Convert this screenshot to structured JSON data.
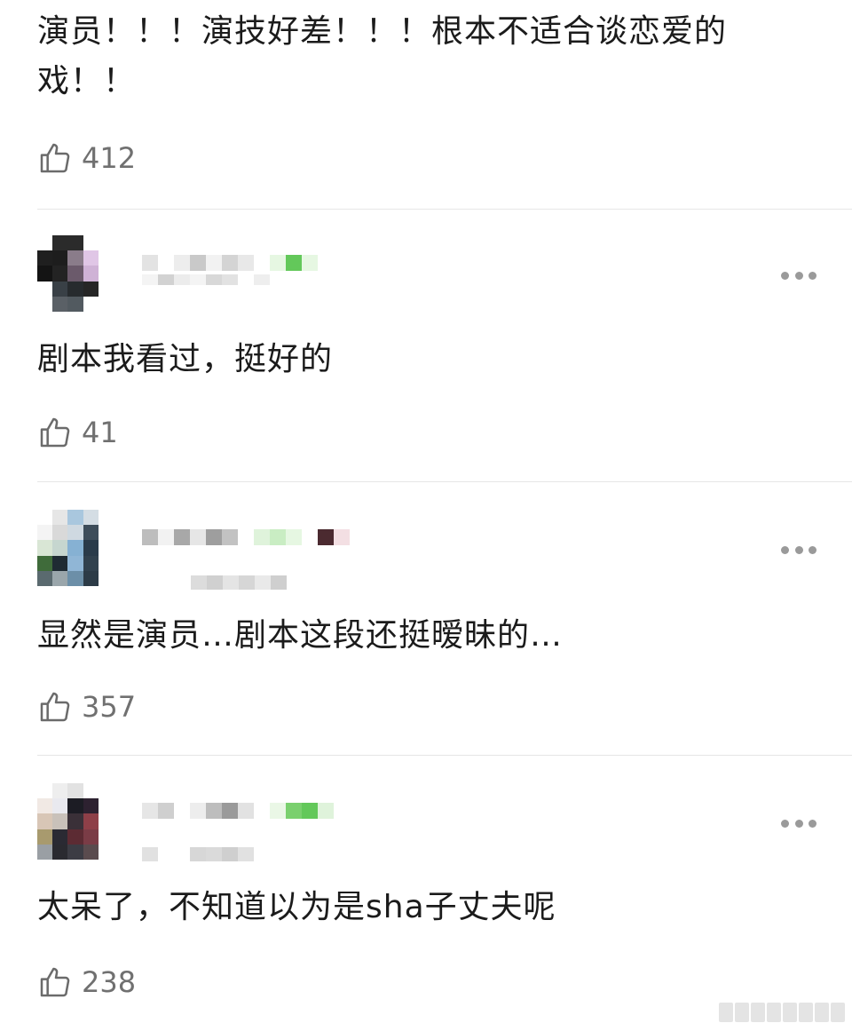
{
  "comments": [
    {
      "text": "演员！！！演技好差！！！根本不适合谈恋爱的戏！！",
      "likes": "412"
    },
    {
      "text": "剧本我看过，挺好的",
      "likes": "41"
    },
    {
      "text": "显然是演员…剧本这段还挺暧昧的…",
      "likes": "357"
    },
    {
      "text": "太呆了，不知道以为是sha子丈夫呢",
      "likes": "238"
    }
  ],
  "icons": {
    "like": "thumbs-up-icon",
    "more": "more-dots-icon"
  },
  "colors": {
    "text": "#1b1b1b",
    "muted": "#707070",
    "divider": "#e6e6e6",
    "dots": "#9a9a9a",
    "green_badge": "#63c85a"
  }
}
